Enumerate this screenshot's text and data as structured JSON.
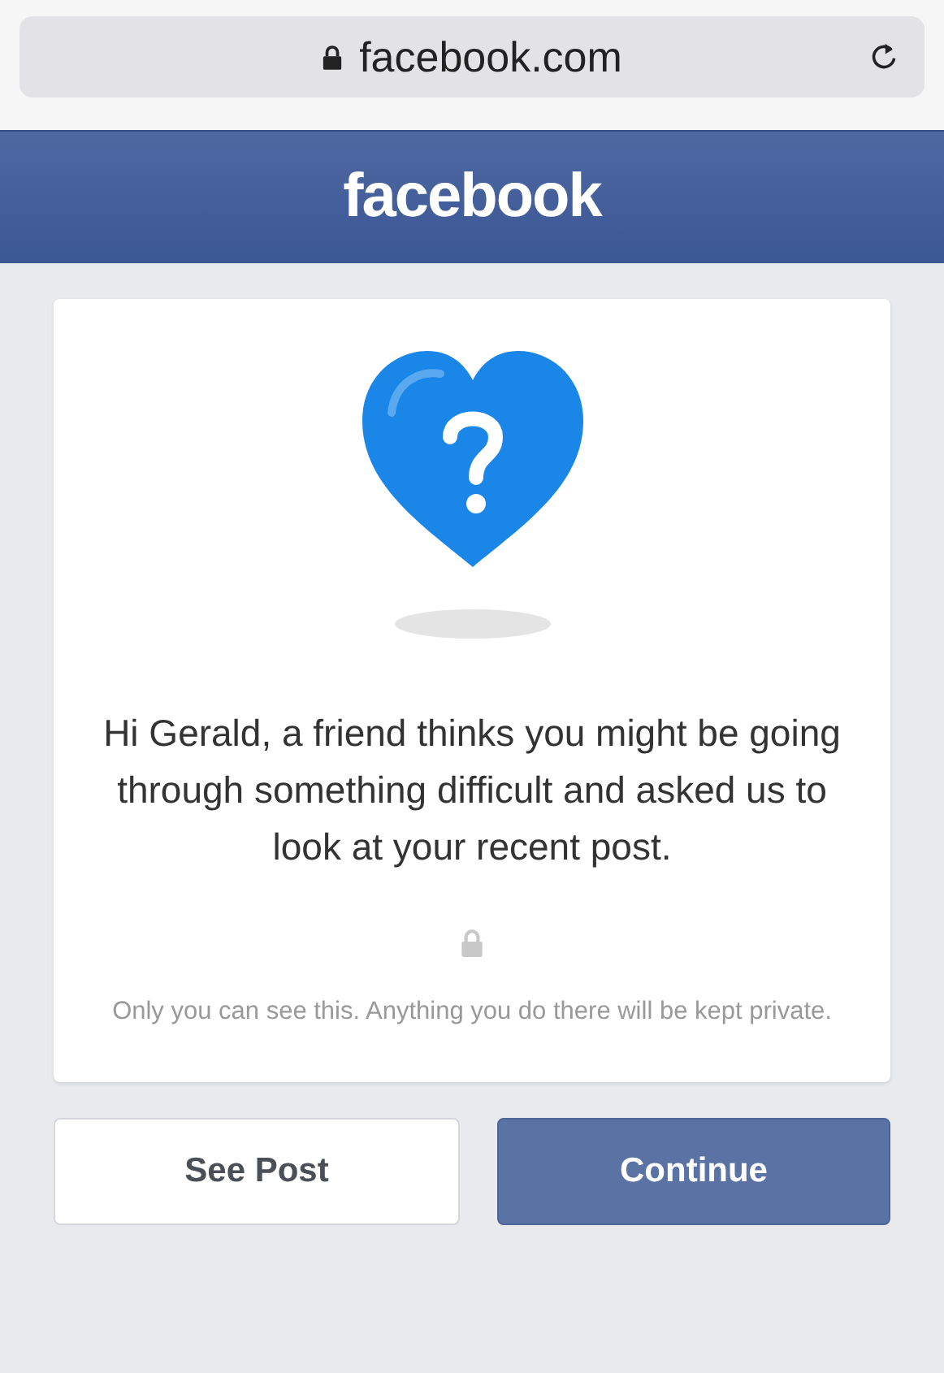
{
  "address_bar": {
    "url": "facebook.com"
  },
  "header": {
    "brand": "facebook"
  },
  "card": {
    "message": "Hi Gerald, a friend thinks you might be going through something difficult and asked us to look at your recent post.",
    "privacy_note": "Only you can see this. Anything you do there will be kept private."
  },
  "buttons": [
    {
      "label": "See Post",
      "kind": "secondary"
    },
    {
      "label": "Continue",
      "kind": "primary"
    }
  ]
}
